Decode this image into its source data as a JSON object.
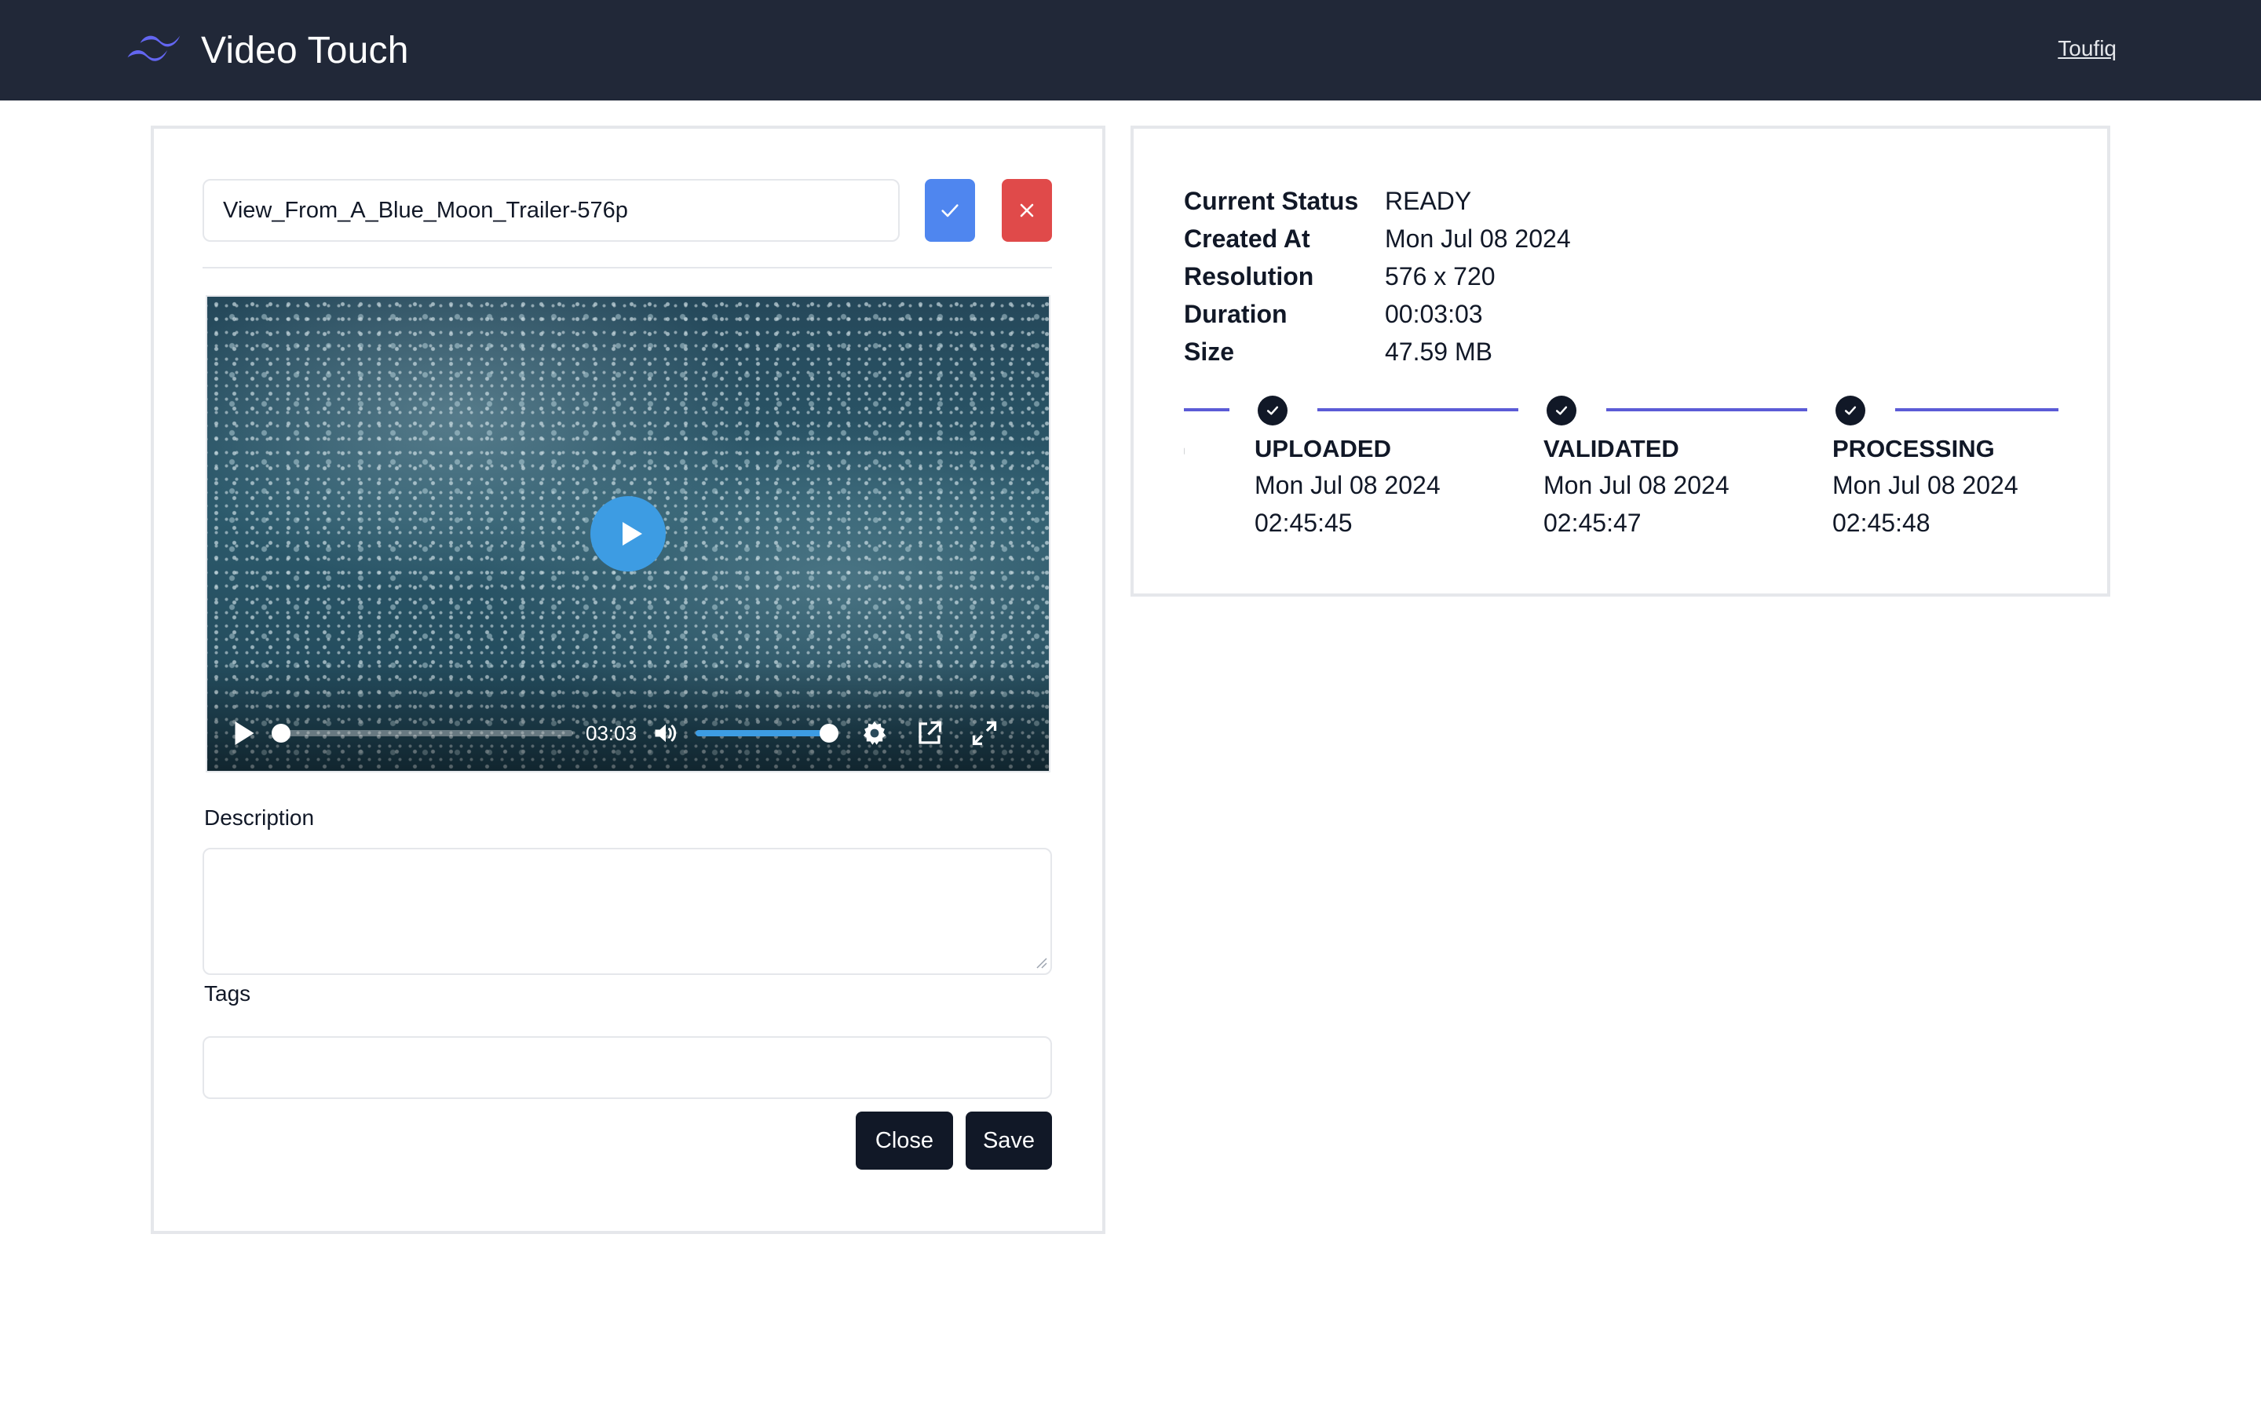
{
  "header": {
    "app_name": "Video Touch",
    "user_name": "Toufiq",
    "logo_color": "#6366f1"
  },
  "editor": {
    "title_value": "View_From_A_Blue_Moon_Trailer-576p",
    "confirm_icon": "check-icon",
    "cancel_icon": "close-icon",
    "confirm_color": "#4f86ef",
    "cancel_color": "#e04a4a",
    "player": {
      "time_display": "03:03",
      "progress_fraction": 0,
      "volume_fraction": 1
    },
    "description_label": "Description",
    "description_value": "",
    "tags_label": "Tags",
    "tags_value": "",
    "close_label": "Close",
    "save_label": "Save"
  },
  "details": {
    "rows": [
      {
        "key": "Current Status",
        "value": "READY"
      },
      {
        "key": "Created At",
        "value": "Mon Jul 08 2024"
      },
      {
        "key": "Resolution",
        "value": "576 x 720"
      },
      {
        "key": "Duration",
        "value": "00:03:03"
      },
      {
        "key": "Size",
        "value": "47.59 MB"
      }
    ],
    "timeline_accent": "#5b5bd6",
    "timeline": [
      {
        "name": "G",
        "date": "",
        "time": ""
      },
      {
        "name": "UPLOADED",
        "date": "Mon Jul 08 2024",
        "time": "02:45:45"
      },
      {
        "name": "VALIDATED",
        "date": "Mon Jul 08 2024",
        "time": "02:45:47"
      },
      {
        "name": "PROCESSING",
        "date": "Mon Jul 08 2024",
        "time": "02:45:48"
      }
    ]
  }
}
